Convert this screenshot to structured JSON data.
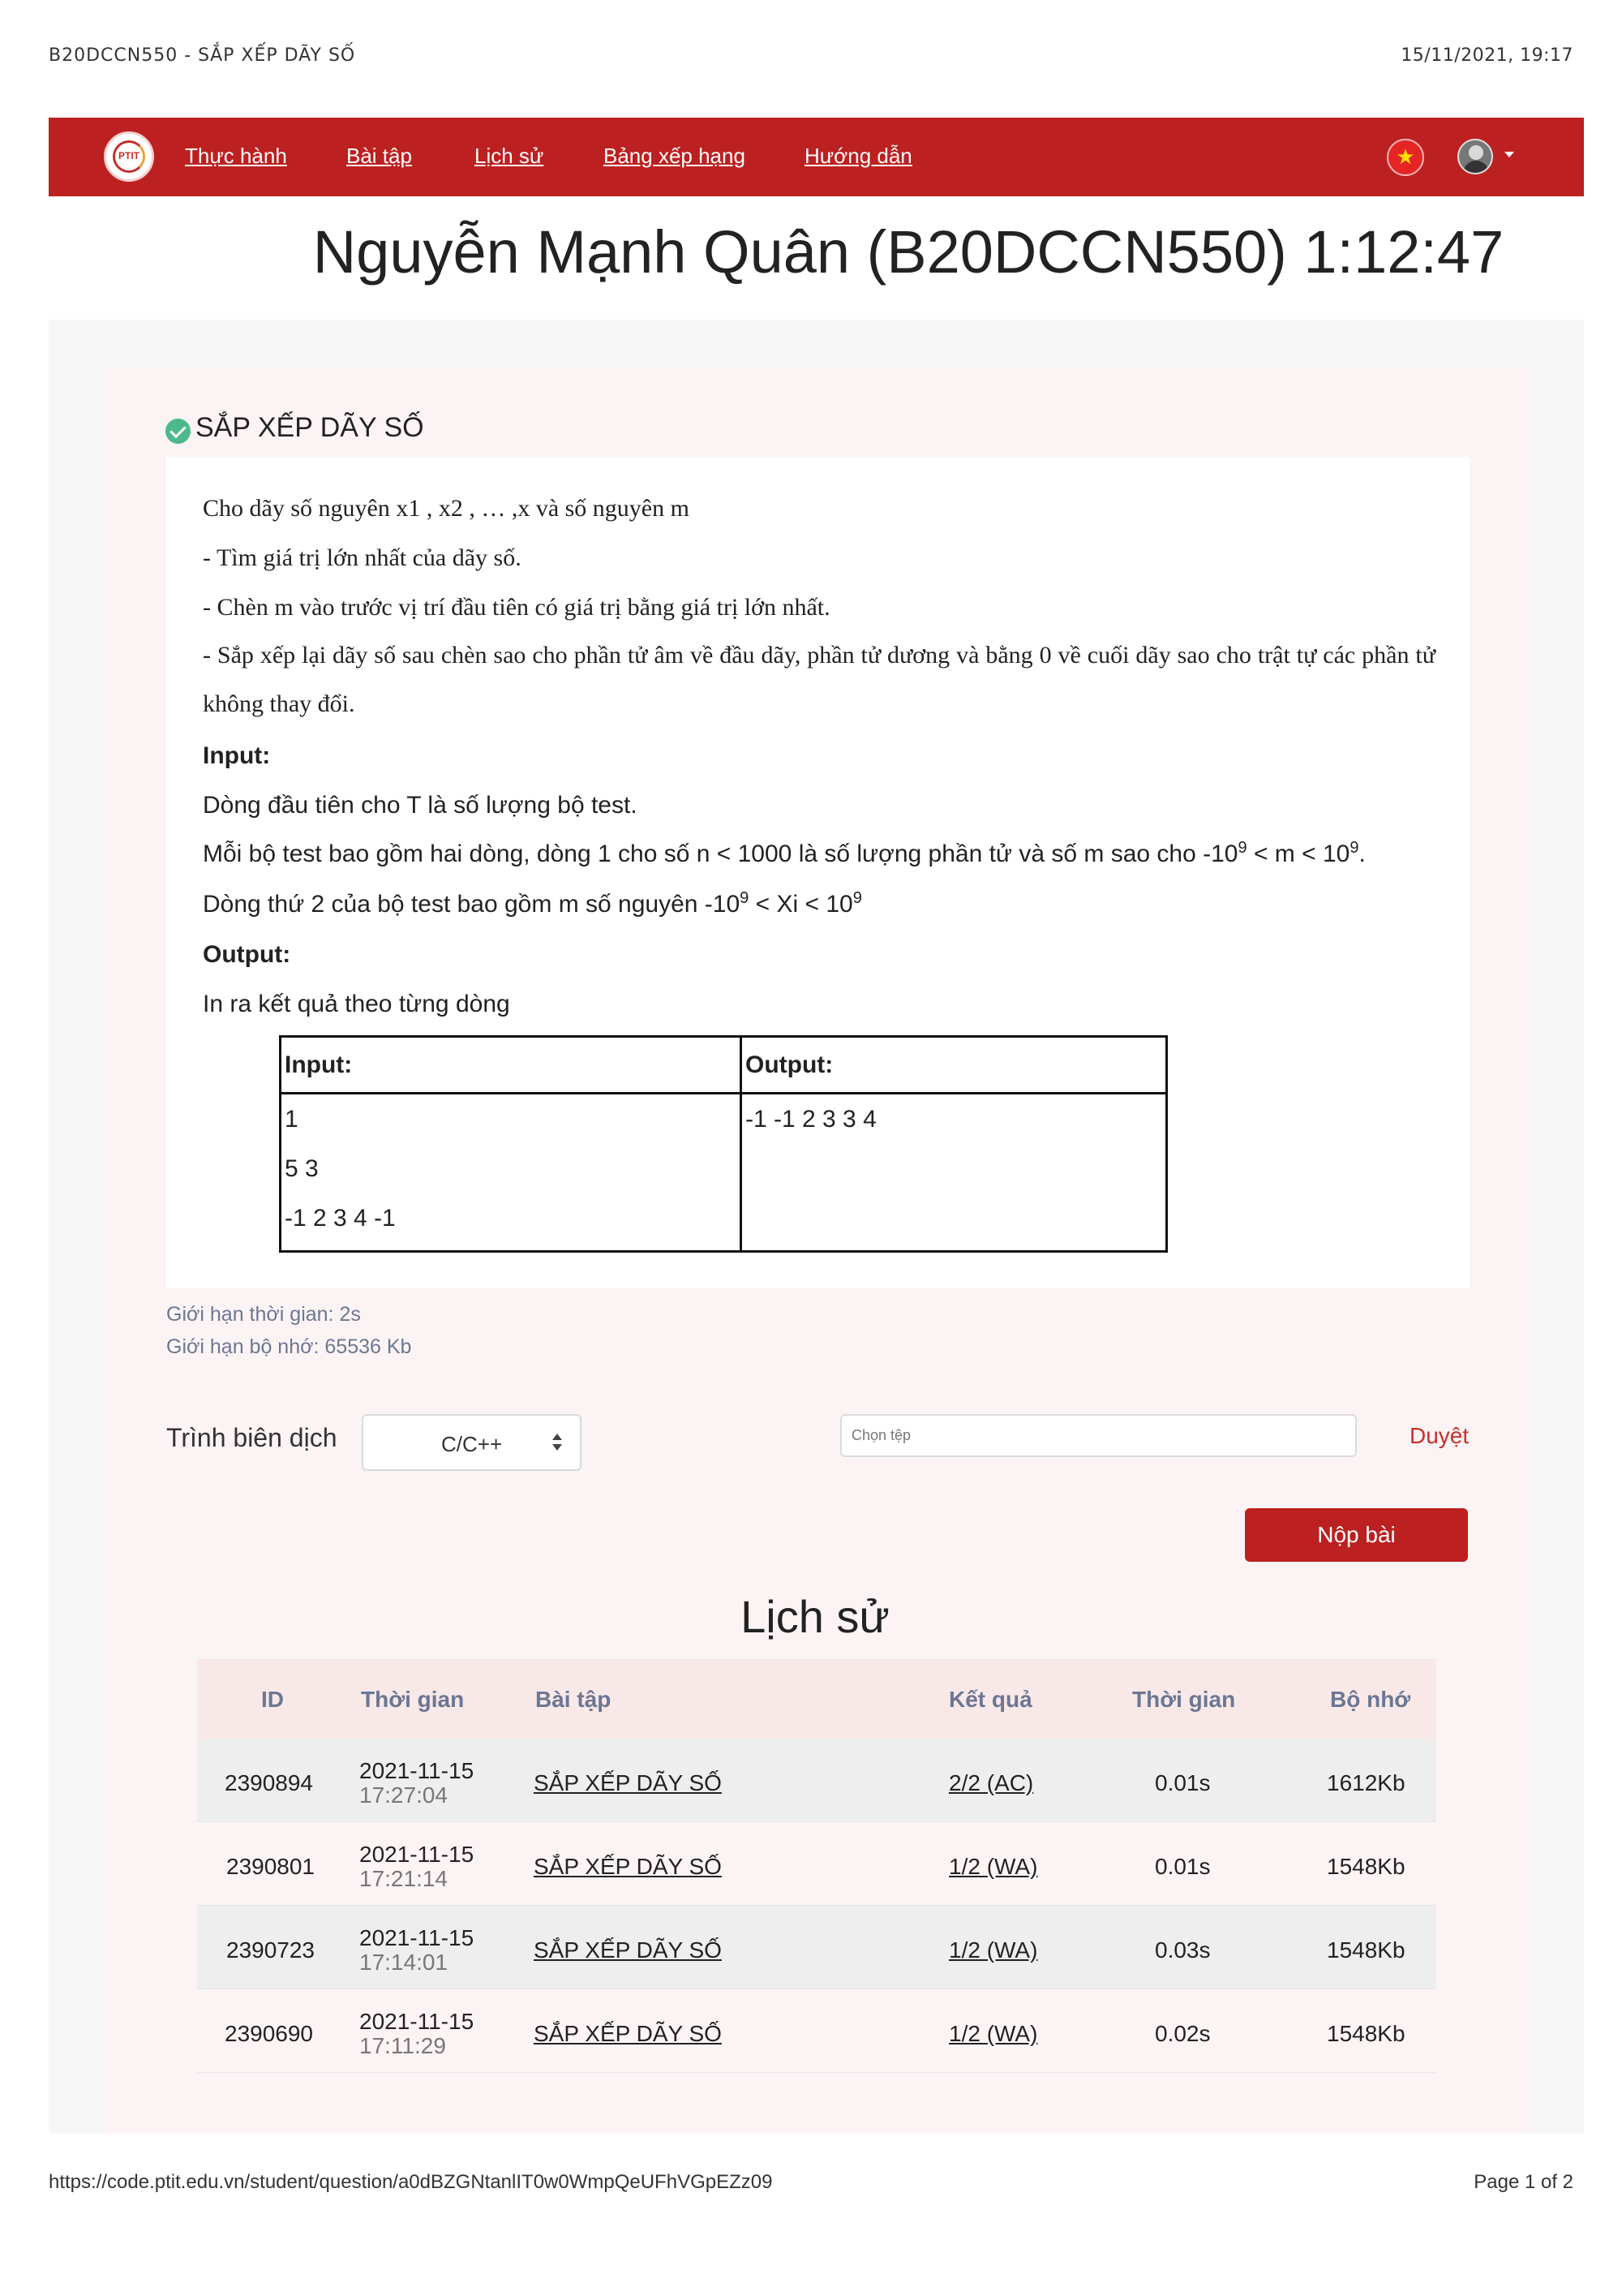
{
  "print_header": {
    "title": "B20DCCN550 - SẮP XẾP DÃY SỐ",
    "datetime": "15/11/2021, 19:17"
  },
  "navbar": {
    "logo_text": "PTIT",
    "links": [
      "Thực hành",
      "Bài tập",
      "Lịch sử",
      "Bảng xếp hạng",
      "Hướng dẫn"
    ],
    "flag_symbol": "★",
    "icons": {
      "flag": "vietnam-flag-icon",
      "avatar": "user-avatar",
      "caret": "caret-down-icon"
    },
    "brand_color": "#bd2020"
  },
  "user_header": {
    "text": "Nguyễn Mạnh Quân (B20DCCN550)  1:12:47"
  },
  "problem": {
    "title": "SẮP XẾP DÃY SỐ",
    "status_icon": "check-circle-icon",
    "status_color": "#4cb98b",
    "statement": {
      "line1": "Cho dãy số nguyên x1 , x2 , … ,x  và số nguyên m",
      "line2": "- Tìm giá trị lớn nhất của dãy số.",
      "line3": "- Chèn m vào trước vị trí đầu tiên có giá trị bằng giá trị lớn nhất.",
      "line4": "- Sắp xếp lại dãy số sau chèn sao cho phần tử âm về đầu dãy, phần tử dương và bằng 0 về cuối dãy sao cho trật tự các phần tử không thay đổi.",
      "input_heading": "Input:",
      "input_line1": "Dòng đầu tiên cho T là số lượng bộ test.",
      "input_line2_a": "Mỗi bộ test bao gồm hai dòng, dòng 1 cho số n < 1000 là số lượng phần tử và số m sao cho  -10",
      "input_line2_exp1": "9",
      "input_line2_b": " < m < 10",
      "input_line2_exp2": "9",
      "input_line2_c": ".",
      "input_line3_a": "Dòng thứ 2 của bộ test bao gồm m số nguyên -10",
      "input_line3_exp1": "9",
      "input_line3_b": " < Xi < 10",
      "input_line3_exp2": "9",
      "output_heading": "Output:",
      "output_line1": "In ra kết quả theo từng dòng"
    },
    "sample": {
      "input_header": "Input:",
      "output_header": "Output:",
      "input_lines": [
        "1",
        "5 3",
        "-1 2 3 4 -1"
      ],
      "output_lines": [
        "-1 -1 2 3 3 4"
      ]
    },
    "time_limit": "Giới hạn thời gian: 2s",
    "memory_limit": "Giới hạn bộ nhớ: 65536 Kb"
  },
  "submit_form": {
    "compiler_label": "Trình biên dịch",
    "compiler_value": "C/C++",
    "file_placeholder": "Chọn tệp",
    "browse_label": "Duyệt",
    "submit_label": "Nộp bài"
  },
  "history": {
    "title": "Lịch sử",
    "columns": [
      "ID",
      "Thời gian",
      "Bài tập",
      "Kết quả",
      "Thời gian",
      "Bộ nhớ"
    ],
    "rows": [
      {
        "id": "2390894",
        "date": "2021-11-15",
        "time": "17:27:04",
        "problem": "SẮP XẾP DÃY SỐ",
        "result": "2/2 (AC)",
        "runtime": "0.01s",
        "memory": "1612Kb"
      },
      {
        "id": "2390801",
        "date": "2021-11-15",
        "time": "17:21:14",
        "problem": "SẮP XẾP DÃY SỐ",
        "result": "1/2 (WA)",
        "runtime": "0.01s",
        "memory": "1548Kb"
      },
      {
        "id": "2390723",
        "date": "2021-11-15",
        "time": "17:14:01",
        "problem": "SẮP XẾP DÃY SỐ",
        "result": "1/2 (WA)",
        "runtime": "0.03s",
        "memory": "1548Kb"
      },
      {
        "id": "2390690",
        "date": "2021-11-15",
        "time": "17:11:29",
        "problem": "SẮP XẾP DÃY SỐ",
        "result": "1/2 (WA)",
        "runtime": "0.02s",
        "memory": "1548Kb"
      }
    ]
  },
  "print_footer": {
    "url": "https://code.ptit.edu.vn/student/question/a0dBZGNtanlIT0w0WmpQeUFhVGpEZz09",
    "page": "Page 1 of 2"
  }
}
